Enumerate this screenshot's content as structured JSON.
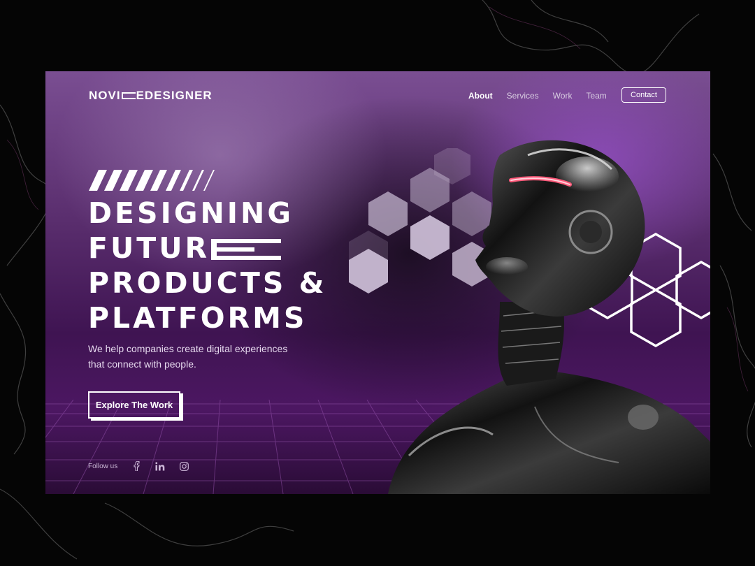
{
  "logo": {
    "part1": "NOVI",
    "part2": "EDESIGNER"
  },
  "nav": {
    "items": [
      {
        "label": "About",
        "active": true
      },
      {
        "label": "Services",
        "active": false
      },
      {
        "label": "Work",
        "active": false
      },
      {
        "label": "Team",
        "active": false
      }
    ],
    "contact_label": "Contact"
  },
  "hero": {
    "headline": [
      "DESIGNING",
      "FUTUR",
      "PRODUCTS &",
      "PLATFORMS"
    ],
    "subtext": "We help companies create digital experiences that connect with people.",
    "cta_label": "Explore The Work"
  },
  "social": {
    "label": "Follow us",
    "icons": [
      "facebook-icon",
      "linkedin-icon",
      "instagram-icon"
    ]
  },
  "colors": {
    "background": "#050505",
    "purple_dark": "#3f1452",
    "purple_light": "#7a4e92",
    "accent_red": "#ff5a7a",
    "text": "#ffffff"
  }
}
